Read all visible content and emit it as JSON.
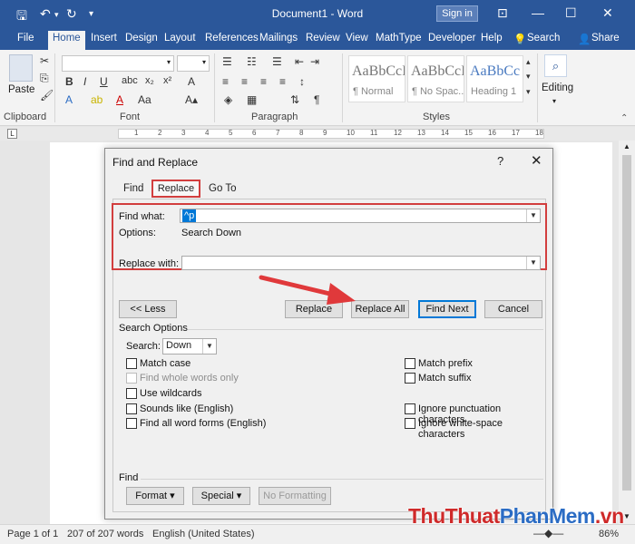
{
  "titlebar": {
    "document_title": "Document1 - Word",
    "signin_label": "Sign in"
  },
  "ribbon_tabs": [
    "File",
    "Home",
    "Insert",
    "Design",
    "Layout",
    "References",
    "Mailings",
    "Review",
    "View",
    "MathType",
    "Developer",
    "Help",
    "Search",
    "Share"
  ],
  "ribbon": {
    "paste_label": "Paste",
    "editing_label": "Editing",
    "groups": {
      "clipboard": "Clipboard",
      "font": "Font",
      "paragraph": "Paragraph",
      "styles": "Styles"
    },
    "styles": [
      {
        "sample": "AaBbCcI",
        "name": "¶ Normal"
      },
      {
        "sample": "AaBbCcI",
        "name": "¶ No Spac..."
      },
      {
        "sample": "AaBbCc",
        "name": "Heading 1"
      }
    ]
  },
  "ruler_marks": [
    "1",
    "2",
    "3",
    "4",
    "5",
    "6",
    "7",
    "8",
    "9",
    "10",
    "11",
    "12",
    "13",
    "14",
    "15",
    "16",
    "17",
    "18"
  ],
  "dialog": {
    "title": "Find and Replace",
    "help": "?",
    "close": "✕",
    "tabs": {
      "find": "Find",
      "replace": "Replace",
      "goto": "Go To"
    },
    "find_what_label": "Find what:",
    "find_what_value": "^p",
    "options_label": "Options:",
    "options_value": "Search Down",
    "replace_with_label": "Replace with:",
    "replace_with_value": "",
    "buttons": {
      "less": "<< Less",
      "replace": "Replace",
      "replace_all": "Replace All",
      "find_next": "Find Next",
      "cancel": "Cancel"
    },
    "search_options_title": "Search Options",
    "search_label": "Search:",
    "search_value": "Down",
    "left_options": [
      {
        "label": "Match case",
        "checked": false,
        "disabled": false
      },
      {
        "label": "Find whole words only",
        "checked": false,
        "disabled": true
      },
      {
        "label": "Use wildcards",
        "checked": false,
        "disabled": false
      },
      {
        "label": "Sounds like (English)",
        "checked": false,
        "disabled": false
      },
      {
        "label": "Find all word forms (English)",
        "checked": false,
        "disabled": false
      }
    ],
    "right_options": [
      {
        "label": "Match prefix",
        "checked": false
      },
      {
        "label": "Match suffix",
        "checked": false
      },
      {
        "label": "Ignore punctuation characters",
        "checked": false
      },
      {
        "label": "Ignore white-space characters",
        "checked": false
      }
    ],
    "find_section_title": "Find",
    "bottom_buttons": {
      "format": "Format ▾",
      "special": "Special ▾",
      "no_formatting": "No Formatting"
    }
  },
  "statusbar": {
    "page": "Page 1 of 1",
    "words": "207 of 207 words",
    "language": "English (United States)",
    "zoom": "86%"
  },
  "watermark": {
    "part1": "ThuThuat",
    "part2": "PhanMem",
    "part3": ".vn"
  },
  "colors": {
    "word_blue": "#2b579a",
    "highlight_red": "#d23e3e",
    "default_button_border": "#0078d7"
  }
}
